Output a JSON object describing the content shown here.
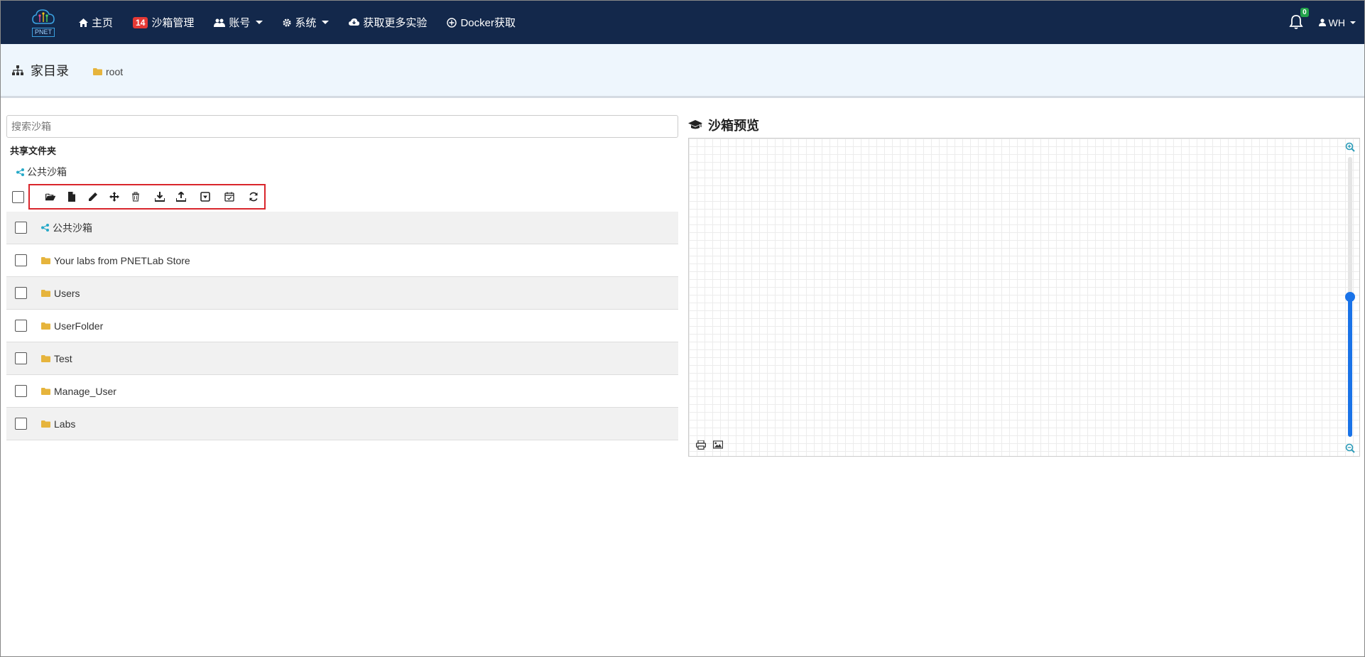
{
  "nav": {
    "logo_text": "PNET",
    "items": [
      {
        "label": "主页",
        "icon": "home-icon"
      },
      {
        "label": "沙箱管理",
        "icon": "badge",
        "badge": "14"
      },
      {
        "label": "账号",
        "icon": "users-icon",
        "dropdown": true
      },
      {
        "label": "系统",
        "icon": "gear-icon",
        "dropdown": true
      },
      {
        "label": "获取更多实验",
        "icon": "cloud-download-icon"
      },
      {
        "label": "Docker获取",
        "icon": "plus-circle-icon"
      }
    ],
    "notifications": "0",
    "user": "WH"
  },
  "crumb": {
    "title": "家目录",
    "root": "root"
  },
  "left": {
    "search_placeholder": "搜索沙箱",
    "shared_label": "共享文件夹",
    "public_label": "公共沙箱",
    "rows": [
      {
        "label": "公共沙箱",
        "icon": "share-icon"
      },
      {
        "label": "Your labs from PNETLab Store",
        "icon": "folder-icon"
      },
      {
        "label": "Users",
        "icon": "folder-icon"
      },
      {
        "label": "UserFolder",
        "icon": "folder-icon"
      },
      {
        "label": "Test",
        "icon": "folder-icon"
      },
      {
        "label": "Manage_User",
        "icon": "folder-icon"
      },
      {
        "label": "Labs",
        "icon": "folder-icon"
      }
    ]
  },
  "right": {
    "title": "沙箱预览",
    "zoom_level": 0.5
  },
  "colors": {
    "nav_bg": "#13284b",
    "crumb_bg": "#eef6fd",
    "folder": "#e6b43c",
    "share": "#26a9c8",
    "accent_blue": "#1a73e8",
    "toolbar_border": "#d9262c"
  }
}
